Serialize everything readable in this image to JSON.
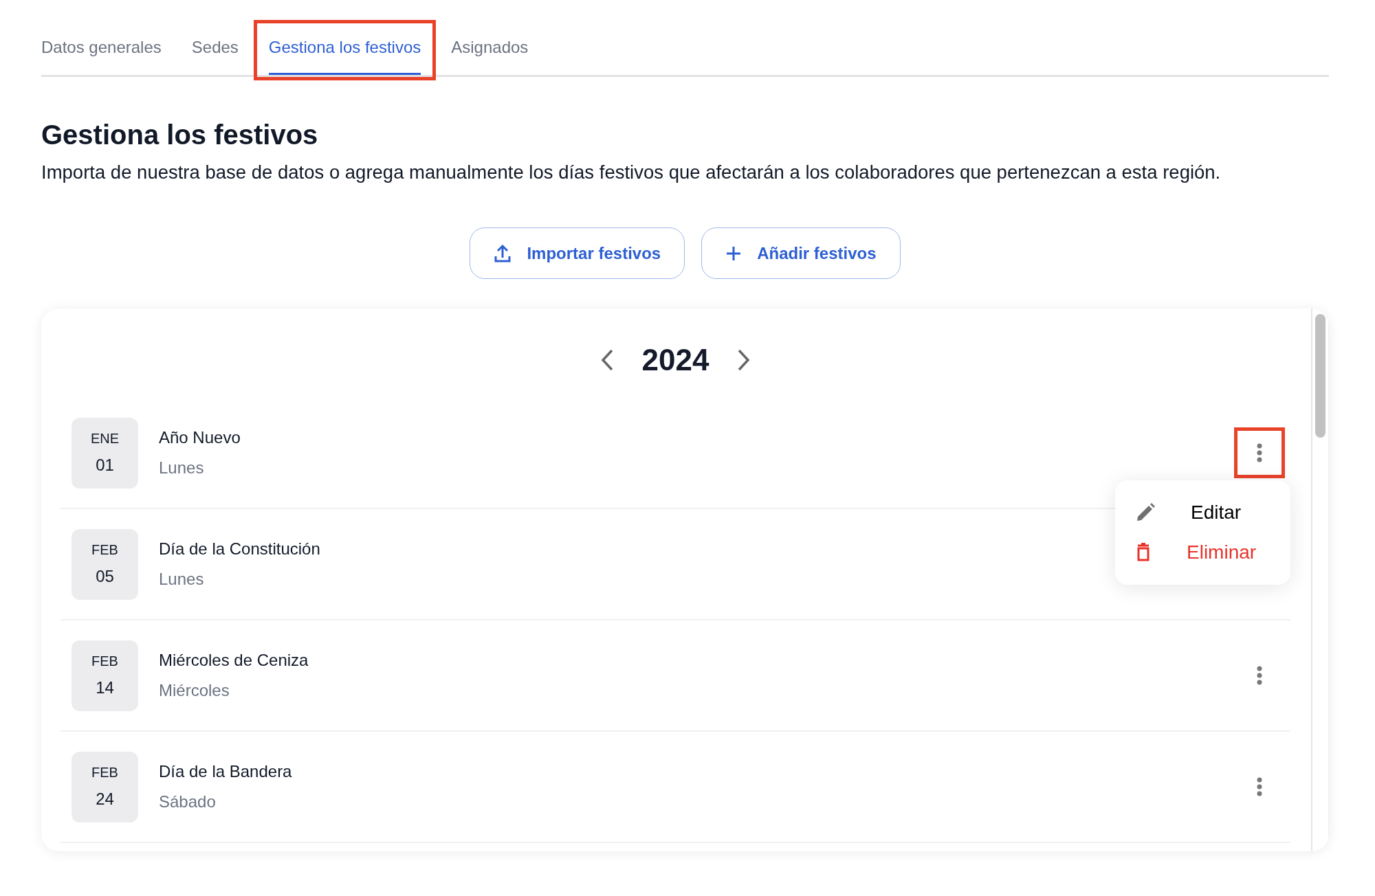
{
  "tabs": [
    {
      "label": "Datos generales",
      "selected": false,
      "highlighted": false
    },
    {
      "label": "Sedes",
      "selected": false,
      "highlighted": false
    },
    {
      "label": "Gestiona los festivos",
      "selected": true,
      "highlighted": true
    },
    {
      "label": "Asignados",
      "selected": false,
      "highlighted": false
    }
  ],
  "heading": "Gestiona los festivos",
  "description": "Importa de nuestra base de datos o agrega manualmente los días festivos que afectarán a los colaboradores que pertenezcan a esta región.",
  "buttons": [
    {
      "label": "Importar festivos",
      "kind": "import"
    },
    {
      "label": "Añadir festivos",
      "kind": "add"
    }
  ],
  "year": "2024",
  "holidays": [
    {
      "month": "ENE",
      "day": "01",
      "name": "Año Nuevo",
      "weekday": "Lunes",
      "menu_highlighted": true,
      "menu_button": true,
      "menu": [
        {
          "label": "Editar",
          "kind": "edit"
        },
        {
          "label": "Eliminar",
          "kind": "delete"
        }
      ]
    },
    {
      "month": "FEB",
      "day": "05",
      "name": "Día de la Constitución",
      "weekday": "Lunes",
      "menu_button": false
    },
    {
      "month": "FEB",
      "day": "14",
      "name": "Miércoles de Ceniza",
      "weekday": "Miércoles",
      "menu_highlighted": false,
      "menu_button": true
    },
    {
      "month": "FEB",
      "day": "24",
      "name": "Día de la Bandera",
      "weekday": "Sábado",
      "menu_highlighted": false,
      "menu_button": true
    }
  ]
}
